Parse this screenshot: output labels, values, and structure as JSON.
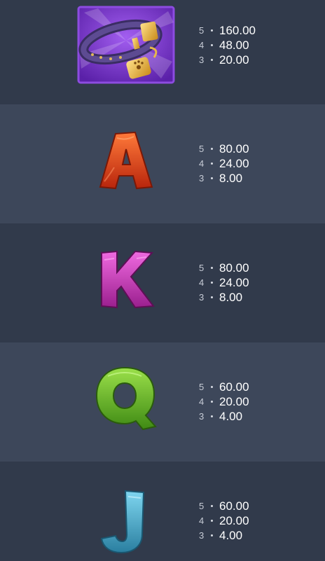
{
  "paytable": [
    {
      "symbol": "collar-icon",
      "pays": [
        {
          "count": "5",
          "amount": "160.00"
        },
        {
          "count": "4",
          "amount": "48.00"
        },
        {
          "count": "3",
          "amount": "20.00"
        }
      ]
    },
    {
      "symbol": "letter-a-icon",
      "pays": [
        {
          "count": "5",
          "amount": "80.00"
        },
        {
          "count": "4",
          "amount": "24.00"
        },
        {
          "count": "3",
          "amount": "8.00"
        }
      ]
    },
    {
      "symbol": "letter-k-icon",
      "pays": [
        {
          "count": "5",
          "amount": "80.00"
        },
        {
          "count": "4",
          "amount": "24.00"
        },
        {
          "count": "3",
          "amount": "8.00"
        }
      ]
    },
    {
      "symbol": "letter-q-icon",
      "pays": [
        {
          "count": "5",
          "amount": "60.00"
        },
        {
          "count": "4",
          "amount": "20.00"
        },
        {
          "count": "3",
          "amount": "4.00"
        }
      ]
    },
    {
      "symbol": "letter-j-icon",
      "pays": [
        {
          "count": "5",
          "amount": "60.00"
        },
        {
          "count": "4",
          "amount": "20.00"
        },
        {
          "count": "3",
          "amount": "4.00"
        }
      ]
    }
  ],
  "colors": {
    "row_dark": "#313a4b",
    "row_light": "#3d475a",
    "collar_frame": "#8a3fd6",
    "letter_a": "#e8481f",
    "letter_k": "#d13ac0",
    "letter_q": "#6fbf2a",
    "letter_j": "#3fa9c9"
  }
}
